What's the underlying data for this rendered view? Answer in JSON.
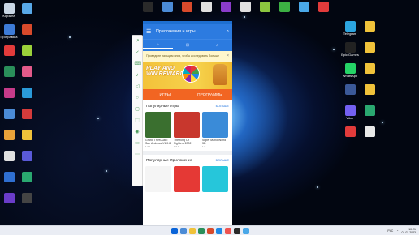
{
  "desktop": {
    "left_icons": [
      {
        "label": "Корзина",
        "color": "#c9d6e6"
      },
      {
        "label": "Программа",
        "color": "#3d7bd8"
      },
      {
        "label": "",
        "color": "#e23b3b"
      },
      {
        "label": "",
        "color": "#2a8f5a"
      },
      {
        "label": "",
        "color": "#c63b8a"
      },
      {
        "label": "",
        "color": "#4b8bd6"
      },
      {
        "label": "",
        "color": "#e8a23a"
      },
      {
        "label": "",
        "color": "#e0e0e0"
      },
      {
        "label": "",
        "color": "#2f6fd1"
      },
      {
        "label": "",
        "color": "#6a3cc9"
      },
      {
        "label": "",
        "color": "#58a8e8"
      },
      {
        "label": "",
        "color": "#d84a2b"
      },
      {
        "label": "",
        "color": "#9bd13a"
      },
      {
        "label": "",
        "color": "#e35a8a"
      },
      {
        "label": "",
        "color": "#2a9ad8"
      },
      {
        "label": "",
        "color": "#d43b3b"
      },
      {
        "label": "",
        "color": "#f0c23a"
      },
      {
        "label": "",
        "color": "#5a5ad8"
      },
      {
        "label": "",
        "color": "#2aa870"
      },
      {
        "label": "",
        "color": "#444444"
      }
    ],
    "right_icons": [
      {
        "label": "Telegram",
        "color": "#2ca5e0"
      },
      {
        "label": "Epic Games",
        "color": "#222222"
      },
      {
        "label": "WhatsApp",
        "color": "#25d366"
      },
      {
        "label": "",
        "color": "#3b5998"
      },
      {
        "label": "Viber",
        "color": "#7360f2"
      },
      {
        "label": "",
        "color": "#e23b3b"
      },
      {
        "label": "",
        "color": "#f0c23a"
      },
      {
        "label": "",
        "color": "#f0c23a"
      },
      {
        "label": "",
        "color": "#f0c23a"
      },
      {
        "label": "",
        "color": "#f0c23a"
      },
      {
        "label": "",
        "color": "#2aa870"
      },
      {
        "label": "",
        "color": "#e8e8e8"
      }
    ],
    "top_icons": [
      {
        "label": "",
        "color": "#2a2a2a"
      },
      {
        "label": "",
        "color": "#4b8bd6"
      },
      {
        "label": "",
        "color": "#d84a2b"
      },
      {
        "label": "",
        "color": "#e0e0e0"
      },
      {
        "label": "",
        "color": "#8a3cc9"
      },
      {
        "label": "",
        "color": "#e0e0e0"
      },
      {
        "label": "",
        "color": "#8cc63f"
      },
      {
        "label": "",
        "color": "#3cb043"
      },
      {
        "label": "",
        "color": "#4aa8e8"
      },
      {
        "label": "",
        "color": "#e23b3b"
      }
    ]
  },
  "emulator": {
    "toolbar_icons": [
      "expand-icon",
      "collapse-icon",
      "keyboard-icon",
      "volume-icon",
      "back-icon",
      "home-icon",
      "recent-icon",
      "screenshot-icon",
      "camera-icon",
      "folder-icon",
      "more-icon"
    ]
  },
  "phone": {
    "header_title": "Приложения и игры",
    "tabs": [
      {
        "label": "⌂",
        "active": true
      },
      {
        "label": "⊞",
        "active": false
      },
      {
        "label": "♫",
        "active": false
      }
    ],
    "notice": "Проведите пальцем вниз, чтобы исследовать больше",
    "banner_line1": "PLAY AND",
    "banner_line2": "WIN REWARDS",
    "segments": [
      "ИГРЫ",
      "ПРОГРАММЫ"
    ],
    "popular_games": {
      "title": "Популярные Игры",
      "more": "БОЛЬШЕ",
      "items": [
        {
          "name": "Grand Theft Auto: San Andreas V1.0.8",
          "meta": "1.08",
          "color": "#3a6f2f"
        },
        {
          "name": "The King Of Fighters 2002 Unique",
          "meta": "1.0.1",
          "color": "#c8372d"
        },
        {
          "name": "Super Mario World 3D",
          "meta": "1.0",
          "color": "#3a8bd8"
        }
      ]
    },
    "popular_apps": {
      "title": "Популярные Приложения",
      "more": "БОЛЬШЕ",
      "items": [
        {
          "color": "#f5f5f5"
        },
        {
          "color": "#e53935"
        },
        {
          "color": "#26c6da"
        }
      ]
    }
  },
  "taskbar": {
    "apps": [
      "#0a64d8",
      "#4b8bd6",
      "#f0c23a",
      "#2a8f5a",
      "#d84a2b",
      "#1e88e5",
      "#ef5350",
      "#2a2a2a",
      "#4aa8e8"
    ],
    "time": "10:21",
    "date": "01.03.2023",
    "lang": "РУС"
  }
}
